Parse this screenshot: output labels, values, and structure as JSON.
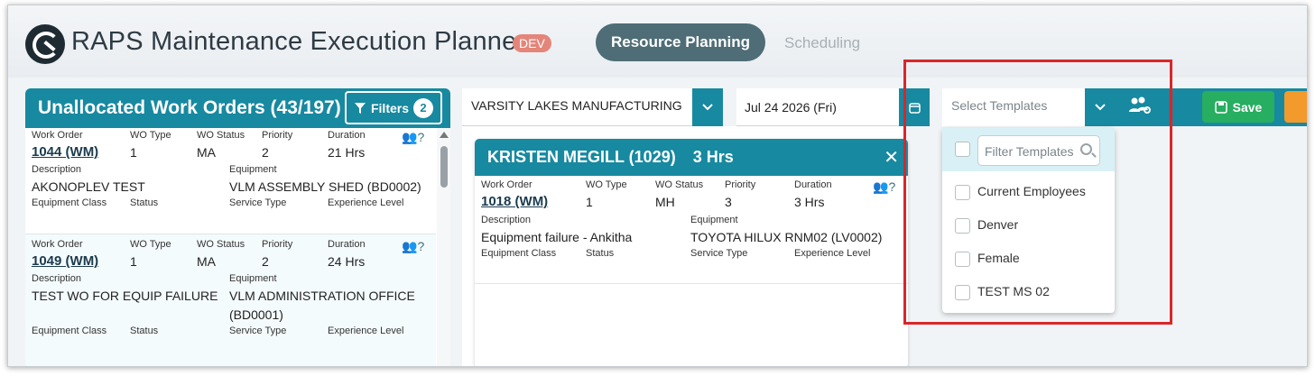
{
  "app": {
    "title": "RAPS Maintenance Execution Planner",
    "env_badge": "DEV"
  },
  "nav": {
    "tabs": [
      {
        "label": "Resource Planning"
      },
      {
        "label": "Scheduling"
      }
    ]
  },
  "left_panel": {
    "title": "Unallocated Work Orders (43/197)",
    "filters_label": "Filters",
    "filters_count": "2",
    "labels": {
      "work_order": "Work Order",
      "wo_type": "WO Type",
      "wo_status": "WO Status",
      "priority": "Priority",
      "duration": "Duration",
      "description": "Description",
      "equipment": "Equipment",
      "equipment_class": "Equipment Class",
      "status": "Status",
      "service_type": "Service Type",
      "experience_level": "Experience Level"
    },
    "work_orders": [
      {
        "id": "1044 (WM)",
        "wo_type": "1",
        "wo_status": "MA",
        "priority": "2",
        "duration": "21 Hrs",
        "description": "AKONOPLEV TEST",
        "equipment": "VLM ASSEMBLY SHED (BD0002)",
        "equipment_line2": ""
      },
      {
        "id": "1049 (WM)",
        "wo_type": "1",
        "wo_status": "MA",
        "priority": "2",
        "duration": "24 Hrs",
        "description": "TEST WO FOR EQUIP FAILURE",
        "equipment": "VLM ADMINISTRATION OFFICE",
        "equipment_line2": "(BD0001)"
      }
    ],
    "assign_icon_suffix": "?"
  },
  "toolbar": {
    "site": "VARSITY LAKES MANUFACTURING",
    "date": "Jul 24 2026 (Fri)",
    "templates_placeholder": "Select Templates",
    "save_label": "Save"
  },
  "resource_card": {
    "name": "KRISTEN MEGILL (1029)",
    "hours": "3 Hrs",
    "work_order": {
      "id": "1018 (WM)",
      "wo_type": "1",
      "wo_status": "MH",
      "priority": "3",
      "duration": "3 Hrs",
      "description": "Equipment failure - Ankitha",
      "equipment": "TOYOTA HILUX RNM02 (LV0002)"
    }
  },
  "template_dropdown": {
    "filter_placeholder": "Filter Templates",
    "options": [
      {
        "label": "Current Employees"
      },
      {
        "label": "Denver"
      },
      {
        "label": "Female"
      },
      {
        "label": "TEST MS 02"
      }
    ]
  },
  "colors": {
    "primary": "#1789a0",
    "save": "#27ae60",
    "highlight": "#d9262b",
    "badge": "#e4857a",
    "tab_active": "#4e6d76"
  },
  "icons": {
    "logo": "raps-logo-icon",
    "filter": "funnel-icon",
    "chevron": "chevron-down-icon",
    "calendar": "calendar-icon",
    "people": "team-settings-icon",
    "save": "floppy-disk-icon",
    "search": "search-icon",
    "close": "close-icon",
    "assign": "assign-people-icon"
  }
}
